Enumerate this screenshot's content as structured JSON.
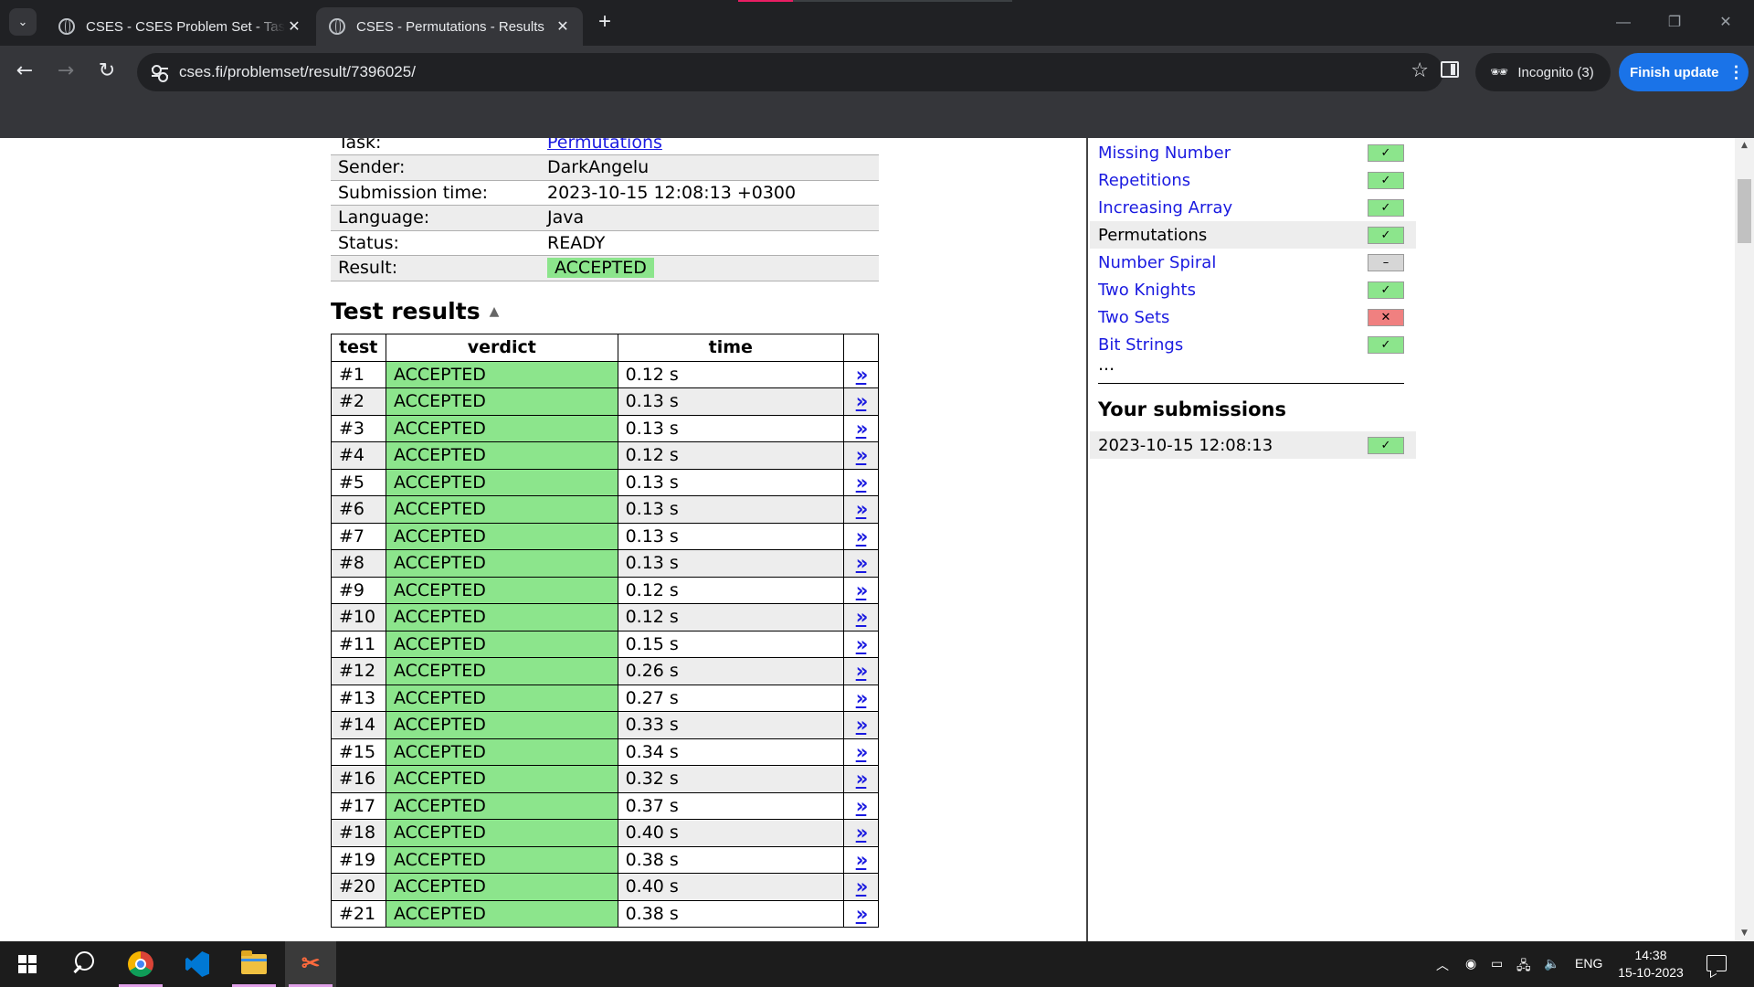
{
  "browser": {
    "tabs": [
      {
        "title": "CSES - CSES Problem Set - Tasks",
        "active": false
      },
      {
        "title": "CSES - Permutations - Results",
        "active": true
      }
    ],
    "new_tab_symbol": "+",
    "address": "cses.fi/problemset/result/7396025/",
    "incognito_label": "Incognito (3)",
    "finish_update_label": "Finish update",
    "icons": {
      "tab_search": "chevron-down-icon",
      "back": "arrow-left-icon",
      "forward": "arrow-right-icon",
      "reload": "reload-icon",
      "site_info": "tune-icon",
      "bookmark": "star-icon",
      "side_panel": "side-panel-icon",
      "incognito": "incognito-icon",
      "menu": "more-vert-icon"
    }
  },
  "submission": {
    "rows": [
      {
        "label": "Task:",
        "value": "Permutations",
        "link": true
      },
      {
        "label": "Sender:",
        "value": "DarkAngelu"
      },
      {
        "label": "Submission time:",
        "value": "2023-10-15 12:08:13 +0300"
      },
      {
        "label": "Language:",
        "value": "Java"
      },
      {
        "label": "Status:",
        "value": "READY"
      },
      {
        "label": "Result:",
        "value": "ACCEPTED",
        "badge": true
      }
    ]
  },
  "test_results": {
    "heading": "Test results",
    "toggle_symbol": "▲",
    "columns": [
      "test",
      "verdict",
      "time"
    ],
    "link_symbol": "»",
    "rows": [
      {
        "test": "#1",
        "verdict": "ACCEPTED",
        "time": "0.12 s"
      },
      {
        "test": "#2",
        "verdict": "ACCEPTED",
        "time": "0.13 s"
      },
      {
        "test": "#3",
        "verdict": "ACCEPTED",
        "time": "0.13 s"
      },
      {
        "test": "#4",
        "verdict": "ACCEPTED",
        "time": "0.12 s"
      },
      {
        "test": "#5",
        "verdict": "ACCEPTED",
        "time": "0.13 s"
      },
      {
        "test": "#6",
        "verdict": "ACCEPTED",
        "time": "0.13 s"
      },
      {
        "test": "#7",
        "verdict": "ACCEPTED",
        "time": "0.13 s"
      },
      {
        "test": "#8",
        "verdict": "ACCEPTED",
        "time": "0.13 s"
      },
      {
        "test": "#9",
        "verdict": "ACCEPTED",
        "time": "0.12 s"
      },
      {
        "test": "#10",
        "verdict": "ACCEPTED",
        "time": "0.12 s"
      },
      {
        "test": "#11",
        "verdict": "ACCEPTED",
        "time": "0.15 s"
      },
      {
        "test": "#12",
        "verdict": "ACCEPTED",
        "time": "0.26 s"
      },
      {
        "test": "#13",
        "verdict": "ACCEPTED",
        "time": "0.27 s"
      },
      {
        "test": "#14",
        "verdict": "ACCEPTED",
        "time": "0.33 s"
      },
      {
        "test": "#15",
        "verdict": "ACCEPTED",
        "time": "0.34 s"
      },
      {
        "test": "#16",
        "verdict": "ACCEPTED",
        "time": "0.32 s"
      },
      {
        "test": "#17",
        "verdict": "ACCEPTED",
        "time": "0.37 s"
      },
      {
        "test": "#18",
        "verdict": "ACCEPTED",
        "time": "0.40 s"
      },
      {
        "test": "#19",
        "verdict": "ACCEPTED",
        "time": "0.38 s"
      },
      {
        "test": "#20",
        "verdict": "ACCEPTED",
        "time": "0.40 s"
      },
      {
        "test": "#21",
        "verdict": "ACCEPTED",
        "time": "0.38 s"
      }
    ]
  },
  "sidebar": {
    "tasks": [
      {
        "name": "Missing Number",
        "status": "ok",
        "symbol": "✓"
      },
      {
        "name": "Repetitions",
        "status": "ok",
        "symbol": "✓"
      },
      {
        "name": "Increasing Array",
        "status": "ok",
        "symbol": "✓"
      },
      {
        "name": "Permutations",
        "status": "ok",
        "symbol": "✓",
        "current": true
      },
      {
        "name": "Number Spiral",
        "status": "none",
        "symbol": "–"
      },
      {
        "name": "Two Knights",
        "status": "ok",
        "symbol": "✓"
      },
      {
        "name": "Two Sets",
        "status": "fail",
        "symbol": "✕"
      },
      {
        "name": "Bit Strings",
        "status": "ok",
        "symbol": "✓"
      }
    ],
    "more": "...",
    "submissions_heading": "Your submissions",
    "submissions": [
      {
        "time": "2023-10-15 12:08:13",
        "status": "ok",
        "symbol": "✓"
      }
    ]
  },
  "taskbar": {
    "apps": [
      "chrome-icon",
      "vscode-icon",
      "file-explorer-icon",
      "snipping-tool-icon"
    ],
    "language": "ENG",
    "time": "14:38",
    "date": "15-10-2023"
  },
  "colors": {
    "accepted_green": "#8ce58c",
    "failed_red": "#f08080",
    "link_blue": "#1a1ae0",
    "update_blue": "#1a73e8"
  }
}
